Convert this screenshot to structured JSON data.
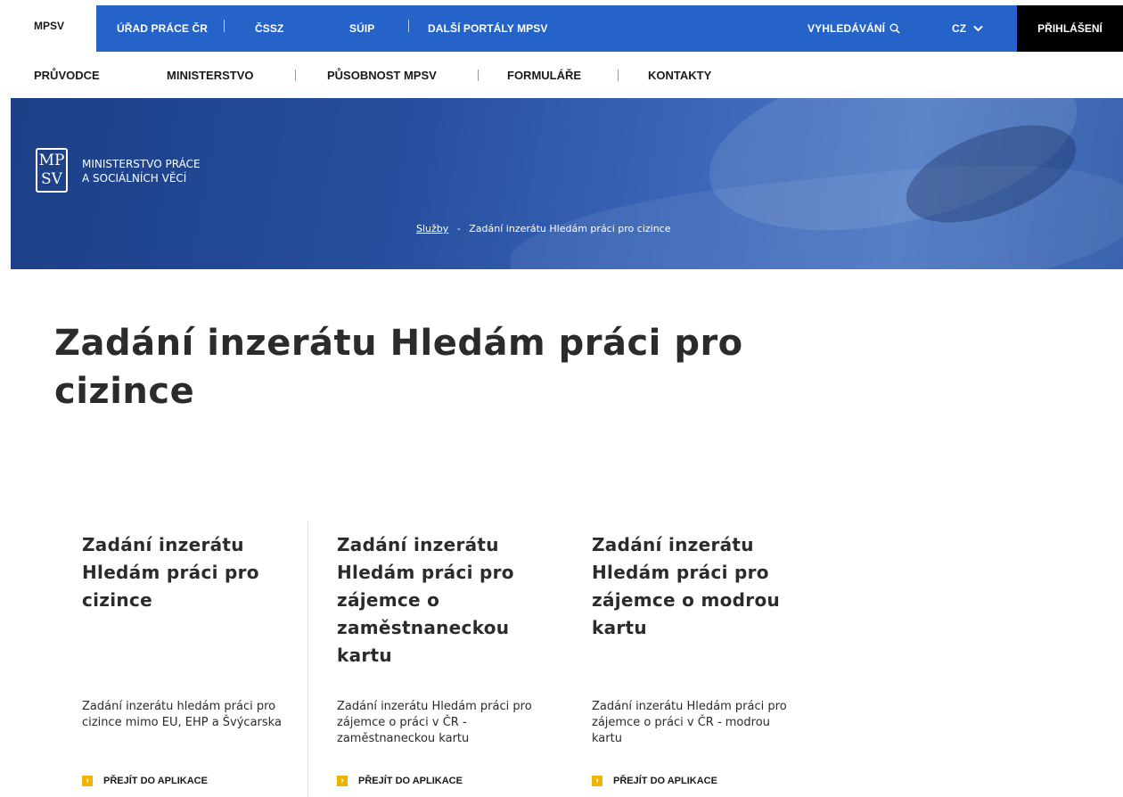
{
  "topbar": {
    "mpsv": "MPSV",
    "links": [
      "ÚŘAD PRÁCE ČR",
      "ČSSZ",
      "SÚIP",
      "DALŠÍ PORTÁLY MPSV"
    ],
    "search_label": "VYHLEDÁVÁNÍ",
    "language": "CZ",
    "login_label": "PŘIHLÁŠENÍ",
    "accent_color": "#2563c9"
  },
  "nav": {
    "items": [
      "PRŮVODCE",
      "MINISTERSTVO",
      "PŮSOBNOST MPSV",
      "FORMULÁŘE",
      "KONTAKTY"
    ]
  },
  "hero": {
    "logo_line1": "MP",
    "logo_line2": "SV",
    "org_line1": "MINISTERSTVO PRÁCE",
    "org_line2": "A SOCIÁLNÍCH VĚCÍ",
    "breadcrumb_link": "Služby",
    "breadcrumb_sep": "-",
    "breadcrumb_current": "Zadání inzerátu Hledám práci pro cizince"
  },
  "main": {
    "title": "Zadání inzerátu Hledám práci pro cizince",
    "cards": [
      {
        "title": "Zadání inzerátu Hledám práci pro cizince",
        "description": "Zadání inzerátu hledám práci pro cizince mimo EU, EHP a Švýcarska",
        "cta": "PŘEJÍT DO APLIKACE"
      },
      {
        "title": "Zadání inzerátu Hledám práci pro zájemce o zaměstnaneckou kartu",
        "description": "Zadání inzerátu Hledám práci pro zájemce o práci v ČR - zaměstnaneckou kartu",
        "cta": "PŘEJÍT DO APLIKACE"
      },
      {
        "title": "Zadání inzerátu Hledám práci pro zájemce o modrou kartu",
        "description": "Zadání inzerátu Hledám práci pro zájemce o práci v ČR - modrou kartu",
        "cta": "PŘEJÍT DO APLIKACE"
      }
    ]
  }
}
